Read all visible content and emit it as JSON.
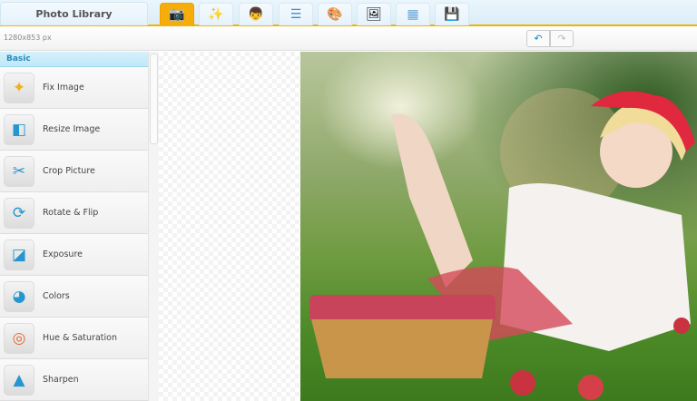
{
  "top_tabs": {
    "library_label": "Photo Library",
    "tools": [
      {
        "icon": "camera-icon",
        "glyph": "📷",
        "active": true
      },
      {
        "icon": "magic-wand-icon",
        "glyph": "✨"
      },
      {
        "icon": "portrait-icon",
        "glyph": "👦"
      },
      {
        "icon": "layers-icon",
        "glyph": "☰"
      },
      {
        "icon": "paint-palette-icon",
        "glyph": "🎨"
      },
      {
        "icon": "frame-icon",
        "glyph": "🖼"
      },
      {
        "icon": "texture-icon",
        "glyph": "▦"
      },
      {
        "icon": "save-icon",
        "glyph": "💾"
      }
    ]
  },
  "toolbar": {
    "dimensions": "1280x853 px",
    "undo": "↶",
    "redo": "↷"
  },
  "sidebar": {
    "section": "Basic",
    "items": [
      {
        "label": "Fix Image",
        "glyph": "✦"
      },
      {
        "label": "Resize Image",
        "glyph": "◧"
      },
      {
        "label": "Crop Picture",
        "glyph": "✂"
      },
      {
        "label": "Rotate & Flip",
        "glyph": "⟳"
      },
      {
        "label": "Exposure",
        "glyph": "◪"
      },
      {
        "label": "Colors",
        "glyph": "◕"
      },
      {
        "label": "Hue & Saturation",
        "glyph": "◎"
      },
      {
        "label": "Sharpen",
        "glyph": "▲"
      }
    ]
  }
}
